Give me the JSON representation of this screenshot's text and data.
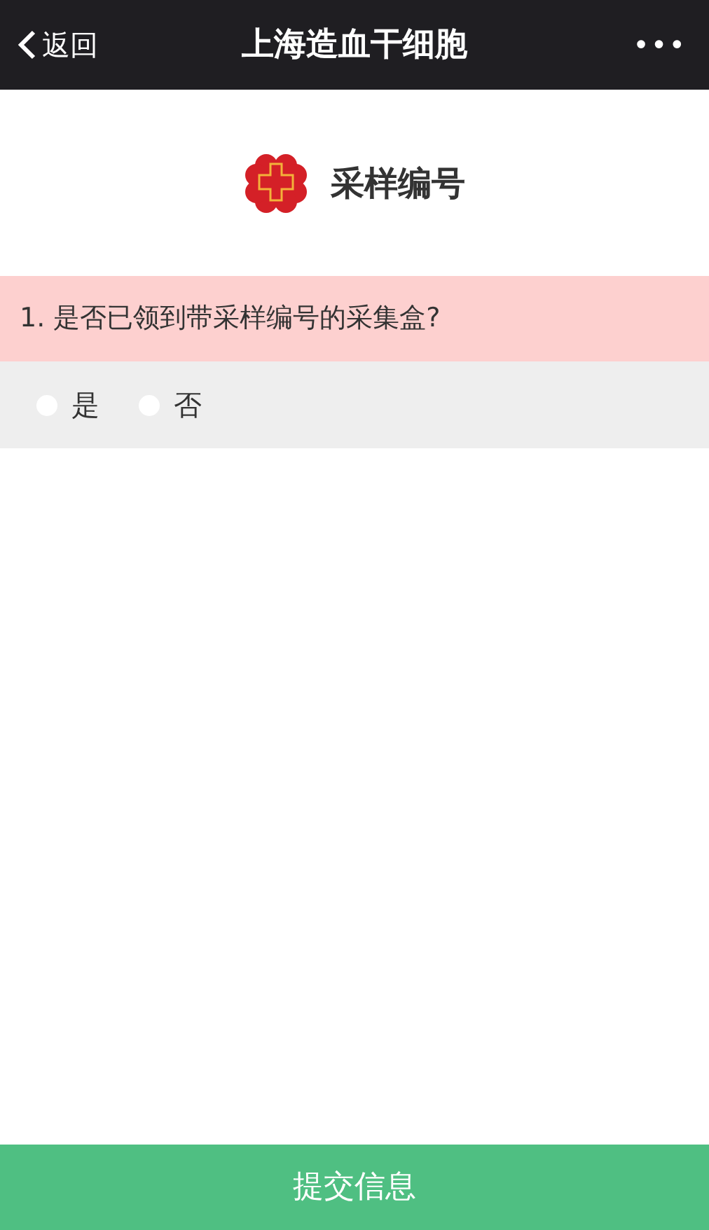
{
  "nav": {
    "back": "返回",
    "title": "上海造血干细胞",
    "more": "•••"
  },
  "header": {
    "title": "采样编号"
  },
  "questions": [
    {
      "text": "1. 是否已领到带采样编号的采集盒?",
      "options": [
        {
          "label": "是",
          "selected": false
        },
        {
          "label": "否",
          "selected": false
        }
      ]
    }
  ],
  "submit": "提交信息"
}
